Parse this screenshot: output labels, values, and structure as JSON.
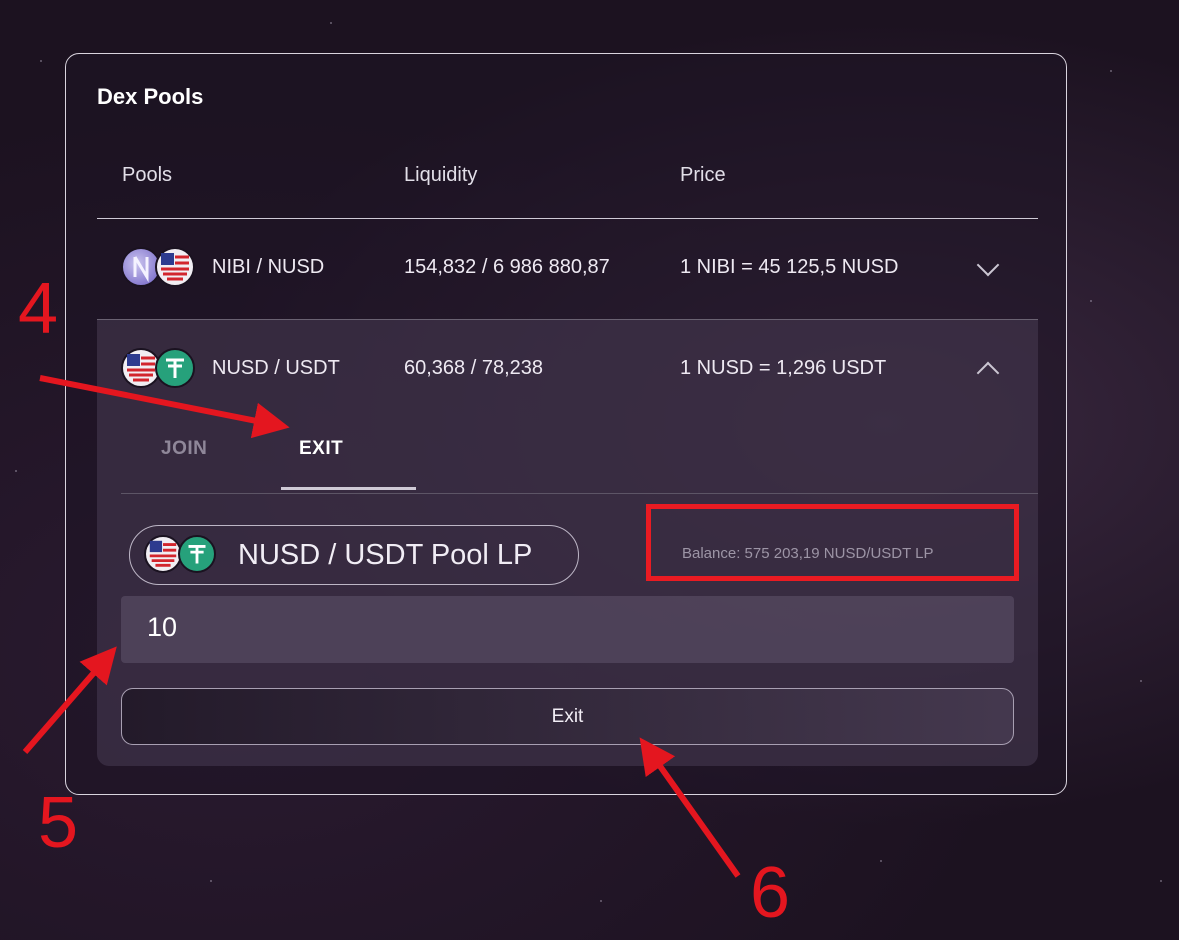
{
  "widget": {
    "title": "Dex Pools"
  },
  "table": {
    "headers": {
      "pools": "Pools",
      "liquidity": "Liquidity",
      "price": "Price"
    },
    "rows": [
      {
        "pair": "NIBI / NUSD",
        "liquidity": "154,832 / 6 986 880,87",
        "price": "1 NIBI = 45 125,5 NUSD",
        "expanded": false
      },
      {
        "pair": "NUSD / USDT",
        "liquidity": "60,368 / 78,238",
        "price": "1 NUSD = 1,296 USDT",
        "expanded": true
      }
    ]
  },
  "panel": {
    "tabs": {
      "join": "JOIN",
      "exit": "EXIT",
      "active": "EXIT"
    },
    "lp_token": "NUSD / USDT Pool LP",
    "balance": "Balance: 575 203,19 NUSD/USDT LP",
    "amount_value": "10",
    "exit_button": "Exit"
  },
  "annotations": {
    "n4": "4",
    "n5": "5",
    "n6": "6"
  },
  "colors": {
    "annotation_red": "#e4161f",
    "tether_green": "#26a17b",
    "nibi_purple": "#8b7bd8"
  }
}
